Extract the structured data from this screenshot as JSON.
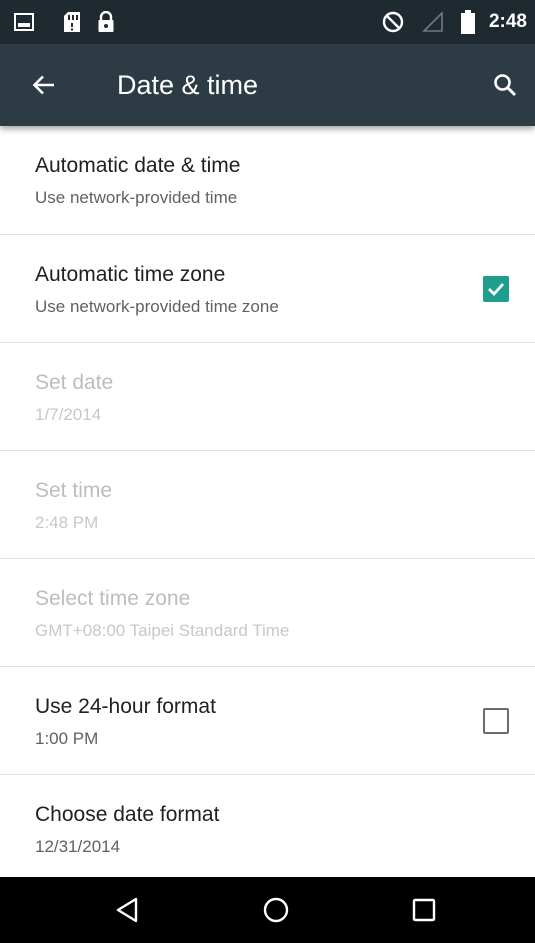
{
  "status_bar": {
    "time": "2:48",
    "icons": [
      "image-icon",
      "sd-card-icon",
      "lock-icon",
      "do-not-disturb-icon",
      "signal-icon",
      "battery-icon"
    ]
  },
  "app_bar": {
    "title": "Date & time",
    "back_icon": "arrow-back-icon",
    "search_icon": "search-icon"
  },
  "settings": [
    {
      "title": "Automatic date & time",
      "summary": "Use network-provided time",
      "enabled": true,
      "checkbox": null
    },
    {
      "title": "Automatic time zone",
      "summary": "Use network-provided time zone",
      "enabled": true,
      "checkbox": "checked"
    },
    {
      "title": "Set date",
      "summary": "1/7/2014",
      "enabled": false,
      "checkbox": null
    },
    {
      "title": "Set time",
      "summary": "2:48 PM",
      "enabled": false,
      "checkbox": null
    },
    {
      "title": "Select time zone",
      "summary": "GMT+08:00 Taipei Standard Time",
      "enabled": false,
      "checkbox": null
    },
    {
      "title": "Use 24-hour format",
      "summary": "1:00 PM",
      "enabled": true,
      "checkbox": "unchecked"
    },
    {
      "title": "Choose date format",
      "summary": "12/31/2014",
      "enabled": true,
      "checkbox": null
    }
  ],
  "nav_bar": {
    "icons": [
      "nav-back-icon",
      "nav-home-icon",
      "nav-recents-icon"
    ]
  },
  "colors": {
    "status_bar": "#1f2a30",
    "app_bar": "#2d3c44",
    "accent": "#1e9e8c"
  }
}
